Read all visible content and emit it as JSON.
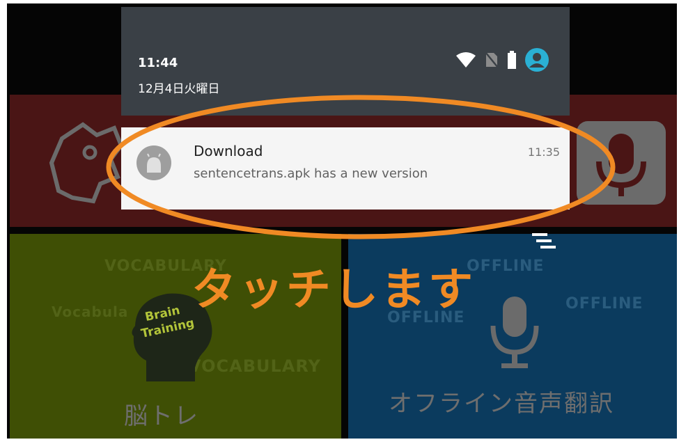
{
  "status_bar": {
    "time": "11:44",
    "date": "12月4日火曜日",
    "icons": [
      "wifi-icon",
      "no-sim-icon",
      "battery-icon",
      "account-icon"
    ]
  },
  "notification": {
    "app_icon": "android-icon",
    "title": "Download",
    "body": "sentencetrans.apk has a new version",
    "time": "11:35"
  },
  "annotation": {
    "callout_text": "タッチします",
    "highlight_color": "#f08a24"
  },
  "tiles": {
    "top": {
      "icons": [
        "robot-head-icon",
        "microphone-icon"
      ]
    },
    "vocabulary": {
      "label": "脳トレ",
      "badge_line1": "Brain",
      "badge_line2": "Training",
      "watermarks": [
        "VOCABULARY",
        "Vocabula",
        "VOCABULARY"
      ]
    },
    "offline": {
      "label": "オフライン音声翻訳",
      "watermarks": [
        "OFFLINE",
        "OFFLINE",
        "OFFLINE"
      ]
    }
  },
  "colors": {
    "shade": "#3a4046",
    "card": "#f5f5f5",
    "tile_red": "#4a1515",
    "tile_green": "#3f4f05",
    "tile_blue": "#0b3b5e",
    "accent": "#2ab0d4"
  }
}
